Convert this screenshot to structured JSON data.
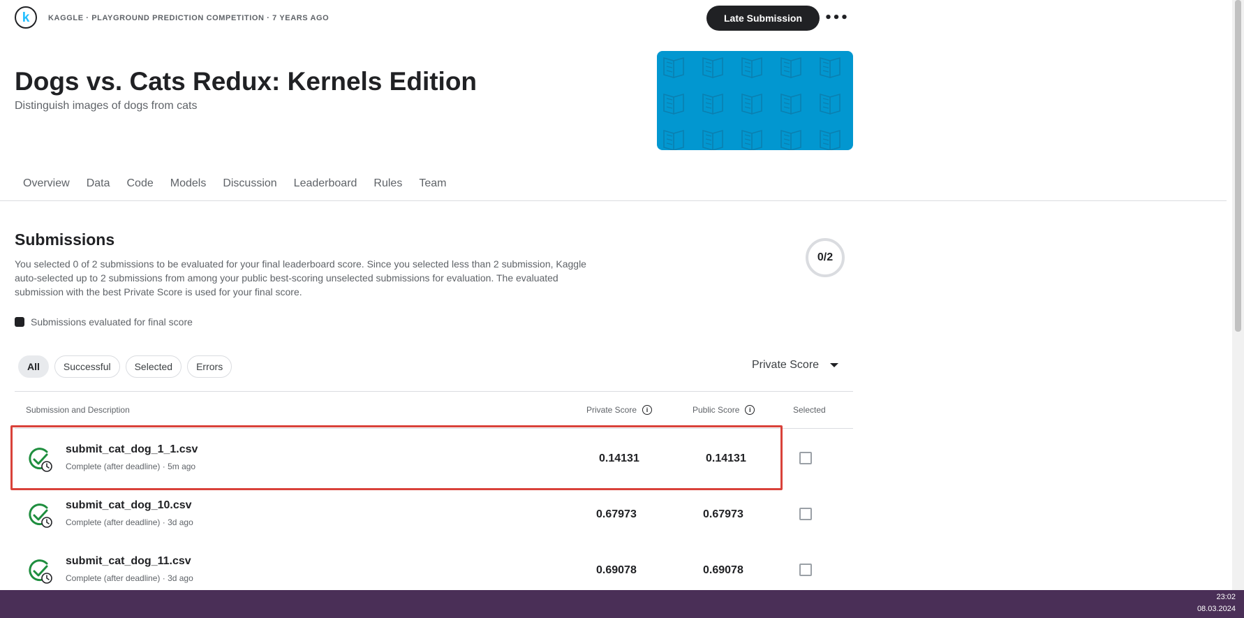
{
  "header": {
    "logo_letter": "k",
    "meta": "KAGGLE · PLAYGROUND PREDICTION COMPETITION · 7 YEARS AGO",
    "late_submission_label": "Late Submission",
    "more_label": "•••"
  },
  "competition": {
    "title": "Dogs vs. Cats Redux: Kernels Edition",
    "subtitle": "Distinguish images of dogs from cats",
    "banner_color": "#0297d0"
  },
  "tabs": [
    {
      "label": "Overview"
    },
    {
      "label": "Data"
    },
    {
      "label": "Code"
    },
    {
      "label": "Models"
    },
    {
      "label": "Discussion"
    },
    {
      "label": "Leaderboard"
    },
    {
      "label": "Rules"
    },
    {
      "label": "Team"
    }
  ],
  "submissions": {
    "title": "Submissions",
    "description": "You selected 0 of 2 submissions to be evaluated for your final leaderboard score. Since you selected less than 2 submission, Kaggle auto-selected up to 2 submissions from among your public best-scoring unselected submissions for evaluation. The evaluated submission with the best Private Score is used for your final score.",
    "counter": "0/2",
    "legend": "Submissions evaluated for final score",
    "filters": [
      {
        "label": "All",
        "active": true
      },
      {
        "label": "Successful",
        "active": false
      },
      {
        "label": "Selected",
        "active": false
      },
      {
        "label": "Errors",
        "active": false
      }
    ],
    "sort_label": "Private Score",
    "columns": {
      "submission": "Submission and Description",
      "private": "Private Score",
      "public": "Public Score",
      "selected": "Selected",
      "info_icon": "i"
    },
    "rows": [
      {
        "file": "submit_cat_dog_1_1.csv",
        "meta": "Complete (after deadline) · 5m ago",
        "private": "0.14131",
        "public": "0.14131",
        "selected": false
      },
      {
        "file": "submit_cat_dog_10.csv",
        "meta": "Complete (after deadline) · 3d ago",
        "private": "0.67973",
        "public": "0.67973",
        "selected": false
      },
      {
        "file": "submit_cat_dog_11.csv",
        "meta": "Complete (after deadline) · 3d ago",
        "private": "0.69078",
        "public": "0.69078",
        "selected": false
      }
    ]
  },
  "taskbar": {
    "time": "23:02",
    "date": "08.03.2024"
  },
  "colors": {
    "accent_dark": "#202124",
    "success_green": "#1e8e3e",
    "highlight_red": "#d9423a",
    "taskbar": "#4a2f57"
  }
}
